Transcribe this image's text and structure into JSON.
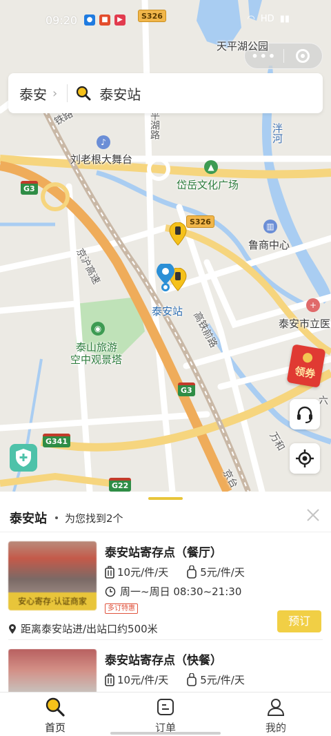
{
  "status_bar": {
    "time": "09:20",
    "network": "HD"
  },
  "capsule": {
    "more_label": "•••"
  },
  "search": {
    "city": "泰安",
    "query": "泰安站"
  },
  "map": {
    "labels": {
      "tianping_park": "天平湖公园",
      "pan_river": "泮河",
      "liulaogen": "刘老根大舞台",
      "daiyue_square": "岱岳文化广场",
      "lushang": "鲁商中心",
      "taian_station": "泰安站",
      "taian_hospital": "泰安市立医",
      "taishan_line1": "泰山旅游",
      "taishan_line2": "空中观景塔",
      "jinghu_expressway": "京沪高速",
      "gaotie_road": "高铁前路",
      "pinghu_road": "平湖路",
      "railway": "铁路",
      "jingtai": "京台",
      "liu": "六",
      "wanhe": "万和"
    },
    "shields": {
      "s326_top": "S326",
      "s326_mid": "S326",
      "g3_left": "G3",
      "g3_mid": "G3",
      "g341": "G341",
      "g22": "G22"
    }
  },
  "red_packet": {
    "label": "领券"
  },
  "sheet": {
    "station": "泰安站",
    "found_text": "为您找到2个",
    "results": [
      {
        "name": "泰安站寄存点（餐厅）",
        "price_luggage": "10元/件/天",
        "price_bag": "5元/件/天",
        "hours": "周一~周日 08:30~21:30",
        "tag": "多订特惠",
        "badge": "安心寄存·认证商家",
        "distance": "距离泰安站进/出站口约500米",
        "book_label": "预订"
      },
      {
        "name": "泰安站寄存点（快餐）",
        "price_luggage": "10元/件/天",
        "price_bag": "5元/件/天"
      }
    ]
  },
  "tabbar": {
    "tabs": [
      {
        "label": "首页"
      },
      {
        "label": "订单"
      },
      {
        "label": "我的"
      }
    ]
  },
  "colors": {
    "accent_yellow": "#f1cf45",
    "badge_yellow": "#e8c53a",
    "shield_green": "#4ec2a9",
    "red_packet": "#e03a33",
    "marker_blue": "#2b8fd6"
  }
}
